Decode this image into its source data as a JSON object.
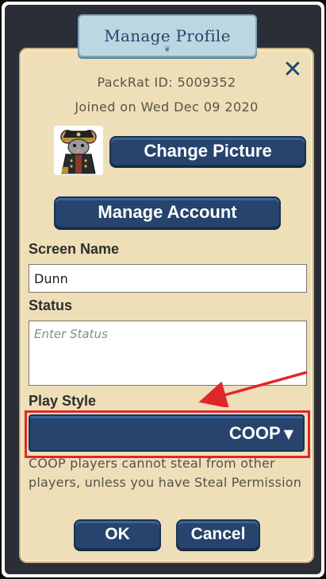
{
  "header": {
    "title": "Manage Profile"
  },
  "profile": {
    "packrat_id": "PackRat ID: 5009352",
    "joined": "Joined on Wed Dec 09 2020"
  },
  "buttons": {
    "change_picture": "Change Picture",
    "manage_account": "Manage Account",
    "ok": "OK",
    "cancel": "Cancel",
    "close_glyph": "✕"
  },
  "fields": {
    "screen_name_label": "Screen Name",
    "screen_name_value": "Dunn",
    "status_label": "Status",
    "status_placeholder": "Enter Status",
    "play_style_label": "Play Style",
    "play_style_value": "COOP"
  },
  "notes": {
    "play_style_description": "COOP players cannot steal from other players, unless you have Steal Permission"
  },
  "colors": {
    "card_bg": "#eedfb8",
    "button_blue": "#26446d",
    "banner_blue": "#bcd6e2",
    "annotation_red": "#e1262a"
  },
  "icons": {
    "close": "close-icon",
    "dropdown": "caret-down-icon",
    "avatar": "rat-avatar-icon"
  }
}
